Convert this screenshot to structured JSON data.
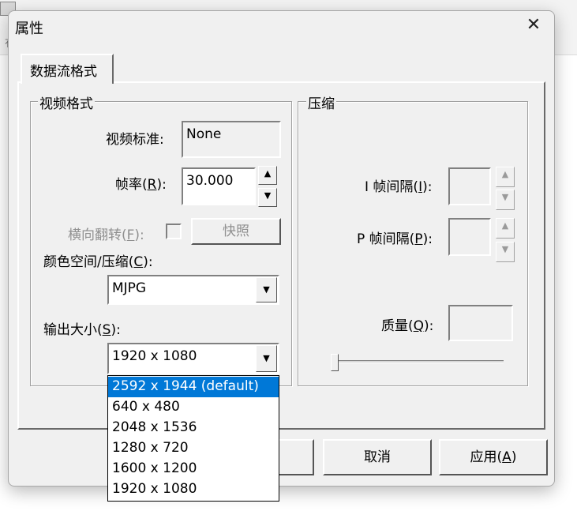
{
  "dialog": {
    "title": "属性",
    "close_glyph": "✕"
  },
  "tab": {
    "label": "数据流格式"
  },
  "video_group": {
    "legend": "视频格式",
    "standard_label": "视频标准:",
    "standard_value": "None",
    "framerate_label": "帧率(R):",
    "framerate_value": "30.000",
    "flip_label": "横向翻转(F):",
    "snapshot_button": "快照",
    "colorspace_label": "颜色空间/压缩(C):",
    "colorspace_value": "MJPG",
    "output_size_label": "输出大小(S):",
    "output_size_value": "1920 x 1080"
  },
  "output_size_options": [
    "2592 x 1944  (default)",
    "640 x 480",
    "2048 x 1536",
    "1280 x 720",
    "1600 x 1200",
    "1920 x 1080"
  ],
  "compress_group": {
    "legend": "压缩",
    "i_frame_label": "I 帧间隔(I):",
    "p_frame_label": "P 帧间隔(P):",
    "quality_label": "质量(Q):"
  },
  "buttons": {
    "cancel": "取消",
    "apply": "应用(A)"
  },
  "icons": {
    "spin_up": "▲",
    "spin_down": "▼",
    "combo_arrow": "▼"
  }
}
